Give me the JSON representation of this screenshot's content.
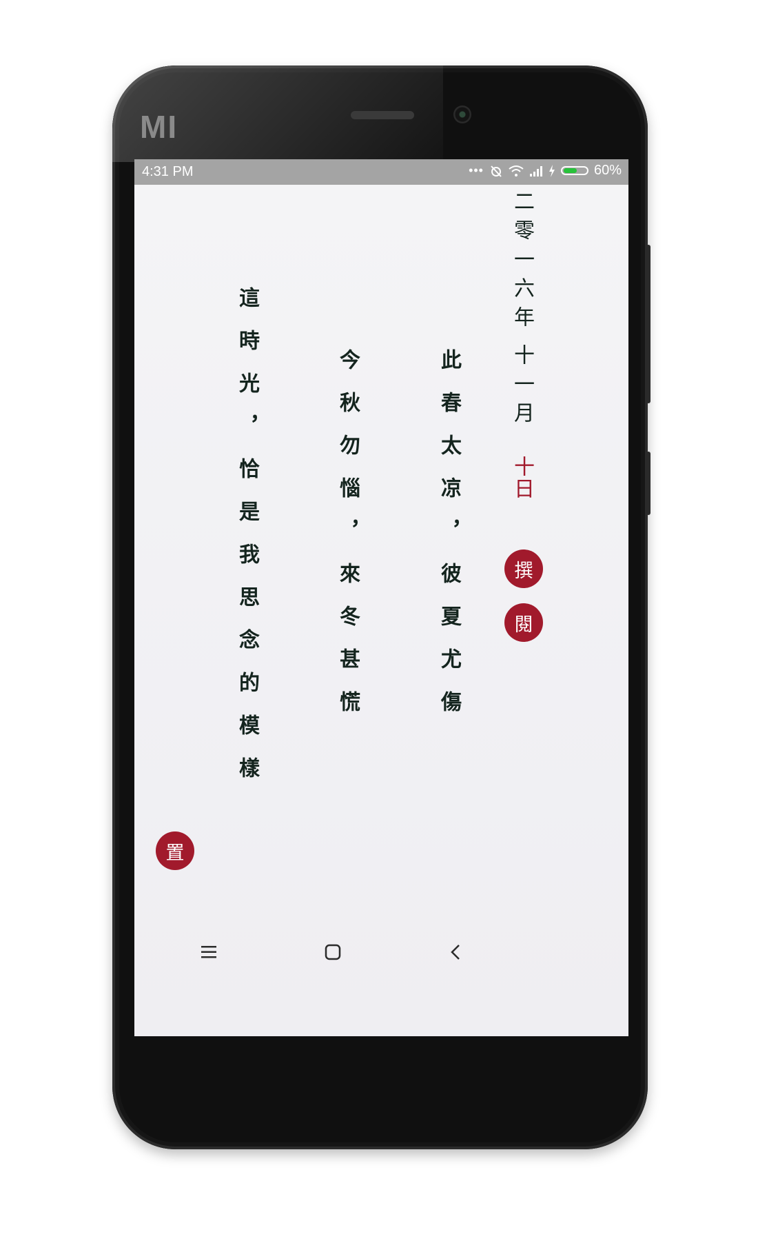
{
  "device": {
    "brand": "MI"
  },
  "status_bar": {
    "time": "4:31 PM",
    "battery_percent": "60%",
    "battery_level": 0.6,
    "battery_color": "#27c23a",
    "icons": [
      "more-dots-icon",
      "alarm-off-icon",
      "wifi-icon",
      "signal-icon",
      "charging-icon",
      "battery-icon"
    ]
  },
  "date": {
    "year": "二零一六年",
    "month": "十一月",
    "day": "十日"
  },
  "actions": {
    "compose": "撰",
    "read": "閱",
    "settings": "置"
  },
  "poem": {
    "lines": [
      "此春太凉，彼夏尤傷",
      "今秋勿惱，來冬甚慌",
      "這時光，恰是我思念的模樣"
    ]
  },
  "nav_bar": {
    "icons": [
      "menu-icon",
      "home-icon",
      "back-icon"
    ]
  },
  "colors": {
    "accent_red": "#a11a2c",
    "ink": "#14241e"
  }
}
